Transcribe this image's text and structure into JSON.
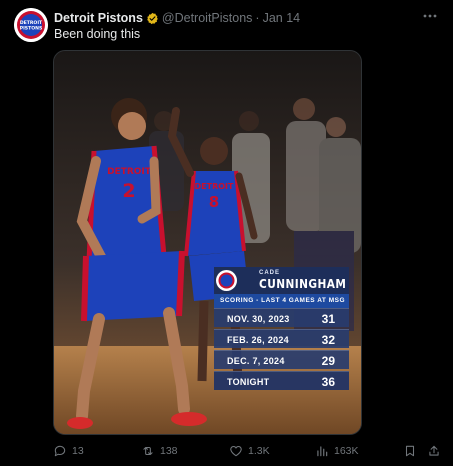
{
  "account": {
    "name": "Detroit Pistons",
    "handle": "@DetroitPistons",
    "separator": "·",
    "date": "Jan 14",
    "avatar_text_top": "DETROIT",
    "avatar_text_bottom": "PISTONS"
  },
  "tweet": {
    "text": "Been doing this"
  },
  "graphic": {
    "first_name": "CADE",
    "last_name": "CUNNINGHAM",
    "subtitle": "SCORING - LAST 4 GAMES AT MSG",
    "rows": [
      {
        "date": "NOV. 30, 2023",
        "points": "31"
      },
      {
        "date": "FEB. 26, 2024",
        "points": "32"
      },
      {
        "date": "DEC. 7, 2024",
        "points": "29"
      },
      {
        "date": "TONIGHT",
        "points": "36"
      }
    ],
    "jersey_left": "2",
    "jersey_right": "8",
    "jersey_text": "DETROIT"
  },
  "actions": {
    "replies": "13",
    "reposts": "138",
    "likes": "1.3K",
    "views": "163K"
  },
  "colors": {
    "accent_blue": "#1d9bf0",
    "verified_gold": "#e2b719",
    "pistons_blue": "#1d42ba",
    "pistons_red": "#c8102e"
  },
  "icons": {
    "more": "more-icon",
    "reply": "reply-icon",
    "repost": "repost-icon",
    "like": "like-icon",
    "views": "views-icon",
    "bookmark": "bookmark-icon",
    "share": "share-icon"
  }
}
